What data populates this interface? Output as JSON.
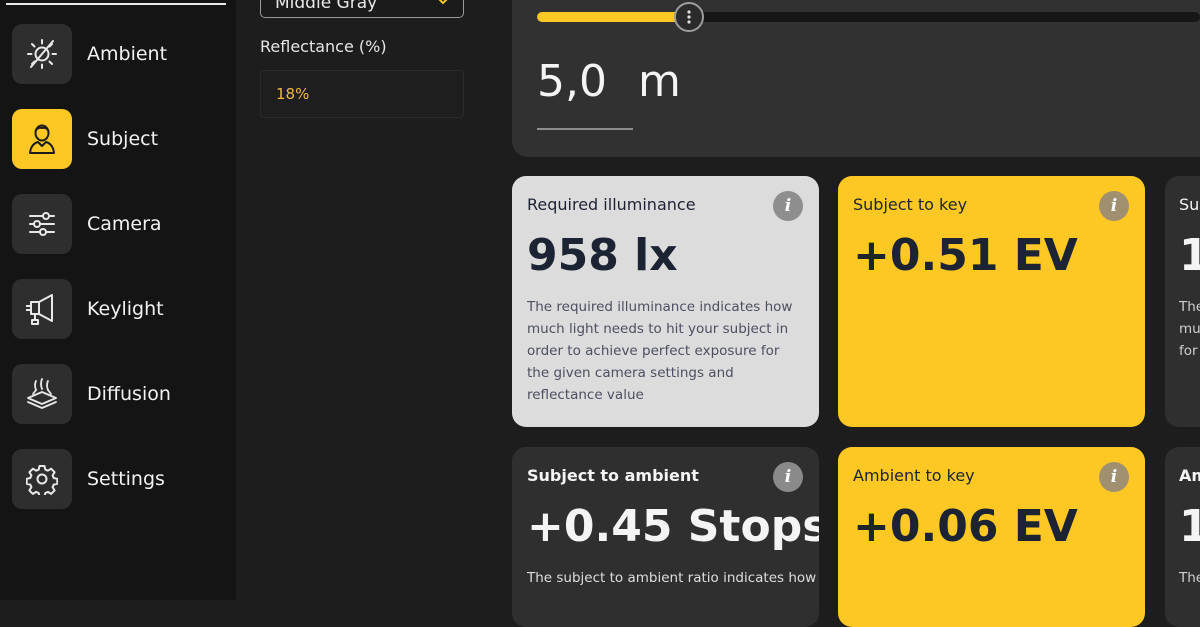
{
  "sidebar": {
    "items": [
      {
        "label": "Ambient",
        "icon": "ambient-off-icon",
        "active": false
      },
      {
        "label": "Subject",
        "icon": "person-icon",
        "active": true
      },
      {
        "label": "Camera",
        "icon": "sliders-icon",
        "active": false
      },
      {
        "label": "Keylight",
        "icon": "softbox-light-icon",
        "active": false
      },
      {
        "label": "Diffusion",
        "icon": "diffusion-icon",
        "active": false
      },
      {
        "label": "Settings",
        "icon": "gear-icon",
        "active": false
      }
    ]
  },
  "subject_panel": {
    "tone_dropdown_value": "Middle Gray",
    "reflectance_label": "Reflectance (%)",
    "reflectance_value": "18%"
  },
  "distance": {
    "value": "5,0",
    "unit": "m",
    "slider_fraction": 0.23
  },
  "cards": [
    {
      "title": "Required illuminance",
      "value": "958 lx",
      "description": "The required illuminance indicates how much light needs to hit your subject in order to achieve perfect exposure for the given camera settings and reflectance value",
      "style": "light"
    },
    {
      "title": "Subject to key",
      "value": "+0.51 EV",
      "description": "",
      "style": "yellow"
    },
    {
      "title": "Su",
      "value": "1",
      "description": "The\nmu\nfor",
      "style": "dark"
    },
    {
      "title": "Subject to ambient",
      "value": "+0.45 Stops",
      "description": "The subject to ambient ratio indicates how",
      "style": "dark"
    },
    {
      "title": "Ambient to key",
      "value": "+0.06 EV",
      "description": "",
      "style": "yellow"
    },
    {
      "title": "Am",
      "value": "1",
      "description": "The",
      "style": "dark"
    }
  ],
  "colors": {
    "accent": "#fdc823",
    "sidebar_bg": "#141414",
    "panel_bg": "#313131",
    "card_light": "#dcdcdc"
  }
}
